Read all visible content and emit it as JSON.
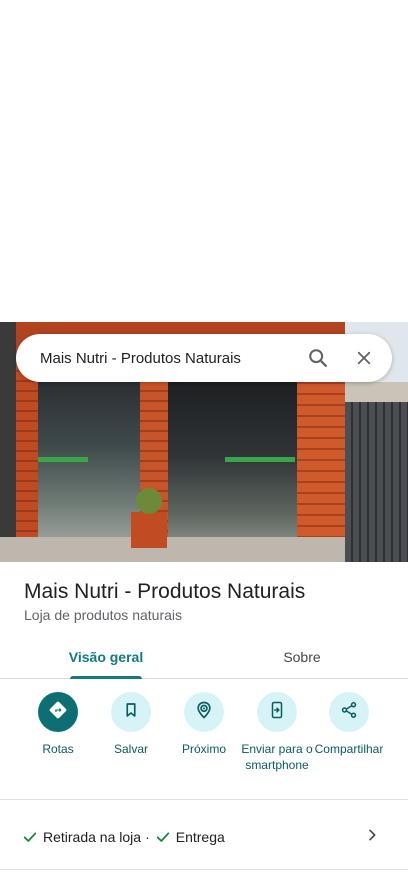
{
  "search": {
    "query": "Mais Nutri - Produtos Naturais"
  },
  "place": {
    "title": "Mais Nutri - Produtos Naturais",
    "category": "Loja de produtos naturais"
  },
  "tabs": [
    {
      "label": "Visão geral",
      "selected": true
    },
    {
      "label": "Sobre",
      "selected": false
    }
  ],
  "actions": [
    {
      "label": "Rotas",
      "icon": "directions-icon"
    },
    {
      "label": "Salvar",
      "icon": "bookmark-icon"
    },
    {
      "label": "Próximo",
      "icon": "nearby-icon"
    },
    {
      "label": "Enviar para o smartphone",
      "icon": "send-to-phone-icon"
    },
    {
      "label": "Compartilhar",
      "icon": "share-icon"
    }
  ],
  "services": [
    {
      "label": "Retirada na loja",
      "icon": "check-icon"
    },
    {
      "label": "Entrega",
      "icon": "check-icon"
    }
  ],
  "colors": {
    "accent": "#137a7f",
    "primary_action": "#0b6f73",
    "action_bg": "#d6f4f7",
    "check": "#188038"
  }
}
